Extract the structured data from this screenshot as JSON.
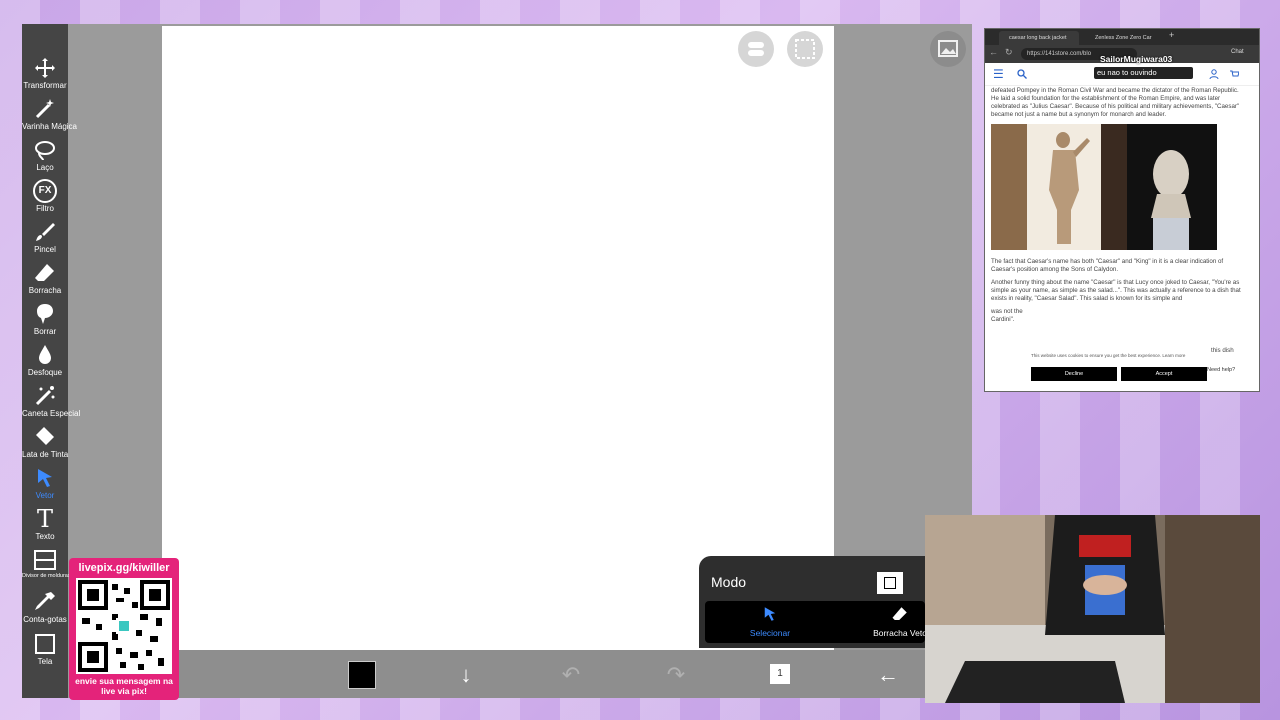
{
  "colors": {
    "toolbar": "#454545",
    "accent": "#3d8bff",
    "background": "#c9a6e8",
    "qr": "#e4237a"
  },
  "tools": [
    {
      "label": "Transformar",
      "icon": "move-icon"
    },
    {
      "label": "Varinha Mágica",
      "icon": "magic-wand-icon"
    },
    {
      "label": "Laço",
      "icon": "lasso-icon"
    },
    {
      "label": "Filtro",
      "icon": "fx-icon",
      "glyph": "FX"
    },
    {
      "label": "Pincel",
      "icon": "brush-icon"
    },
    {
      "label": "Borracha",
      "icon": "eraser-icon"
    },
    {
      "label": "Borrar",
      "icon": "smudge-icon"
    },
    {
      "label": "Desfoque",
      "icon": "blur-drop-icon"
    },
    {
      "label": "Caneta Especial",
      "icon": "special-pen-icon"
    },
    {
      "label": "Lata de Tinta",
      "icon": "paint-bucket-icon"
    },
    {
      "label": "Vetor",
      "icon": "vector-arrow-icon",
      "active": true
    },
    {
      "label": "Texto",
      "icon": "text-icon",
      "glyph": "T"
    },
    {
      "label": "Divisor de molduras",
      "icon": "frame-divider-icon"
    },
    {
      "label": "Conta-gotas",
      "icon": "eyedropper-icon"
    },
    {
      "label": "Tela",
      "icon": "canvas-icon"
    }
  ],
  "modo": {
    "title": "Modo",
    "select_label": "Selecionar",
    "eraser_label": "Borracha Veto"
  },
  "bottombar": {
    "layer_count": "1",
    "color": "#000000"
  },
  "qr": {
    "title": "livepix.gg/kiwiller",
    "footer": "envie sua mensagem na live via pix!"
  },
  "browser": {
    "tabs": [
      "caesar long back jacket",
      "Zenless Zone Zero Car"
    ],
    "url": "https://141store.com/blo",
    "chat_label": "Chat",
    "paragraphs": [
      "defeated Pompey in the Roman Civil War and became the dictator of the Roman Republic. He laid a solid foundation for the establishment of the Roman Empire, and was later celebrated as \"Julius Caesar\". Because of his political and military achievements, \"Caesar\" became not just a name but a synonym for monarch and leader.",
      "The fact that Caesar's name has both \"Caesar\" and \"King\" in it is a clear indication of Caesar's position among the Sons of Calydon.",
      "Another funny thing about the name \"Caesar\" is that Lucy once joked to Caesar, \"You're as simple as your name, as simple as the salad...\". This was actually a reference to a dish that exists in reality, \"Caesar Salad\". This salad is known for its simple and",
      "was not the",
      "Cardini\"."
    ],
    "right_fragment": "this dish",
    "cookie": {
      "text": "This website uses cookies to ensure you get the best experience.",
      "learn_more": "Learn more",
      "decline": "Decline",
      "accept": "Accept"
    },
    "need_help": "Need help?"
  },
  "overlay": {
    "username": "SailorMugiwara03",
    "message": "eu nao to ouvindo"
  }
}
